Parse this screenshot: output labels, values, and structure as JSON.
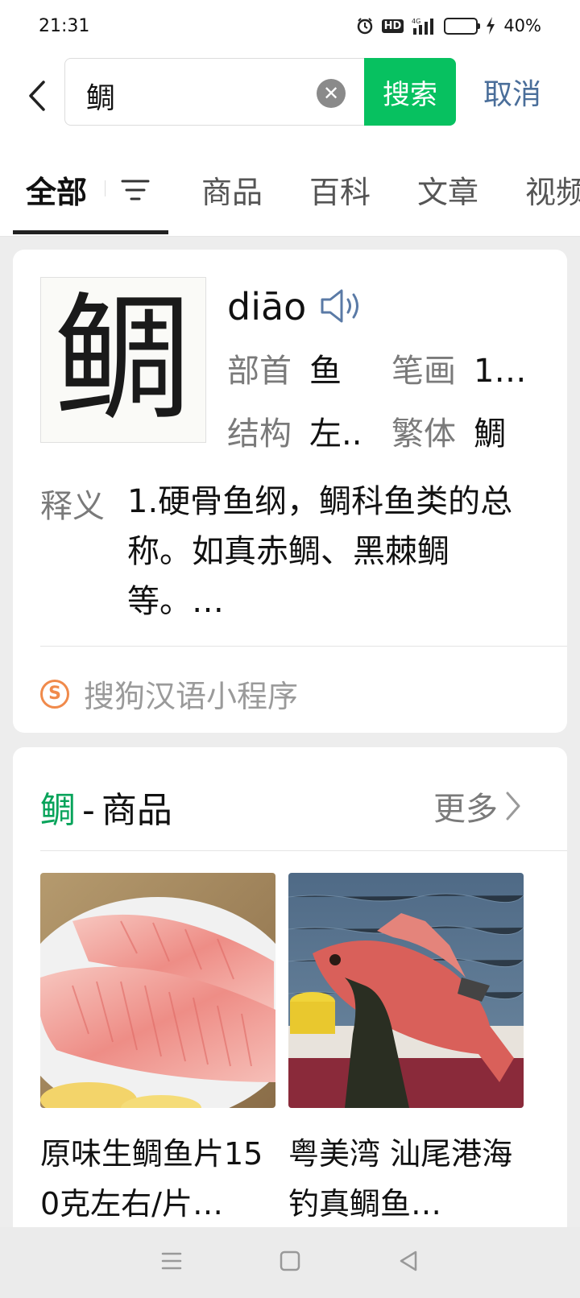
{
  "status_bar": {
    "time": "21:31",
    "hd_label": "HD",
    "network_label": "4G",
    "battery_percent": "40%",
    "battery_level": 0.4,
    "icons": [
      "alarm-icon",
      "hd-icon",
      "signal-icon",
      "battery-icon",
      "charging-icon"
    ]
  },
  "search": {
    "query": "鲷",
    "search_label": "搜索",
    "cancel_label": "取消"
  },
  "tabs": [
    {
      "label": "全部",
      "active": true
    },
    {
      "label": "商品"
    },
    {
      "label": "百科"
    },
    {
      "label": "文章"
    },
    {
      "label": "视频"
    }
  ],
  "dictionary": {
    "character": "鲷",
    "pinyin": "diāo",
    "radical_label": "部首",
    "radical": "鱼",
    "strokes_label": "笔画",
    "strokes": "1…",
    "structure_label": "结构",
    "structure": "左..",
    "traditional_label": "繁体",
    "traditional": "鯛",
    "meaning_label": "释义",
    "meaning": "1.硬骨鱼纲，鲷科鱼类的总称。如真赤鲷、黑棘鲷等。…",
    "source": "搜狗汉语小程序"
  },
  "goods": {
    "keyword": "鲷",
    "separator": "-",
    "section_label": "商品",
    "more_label": "更多",
    "items": [
      {
        "name": "原味生鲷鱼片150克左右/片…"
      },
      {
        "name": "粤美湾 汕尾港海钓真鲷鱼…"
      }
    ]
  },
  "colors": {
    "accent_green": "#07c160",
    "link_blue": "#4a6e9a",
    "keyword_green": "#07a35a"
  }
}
